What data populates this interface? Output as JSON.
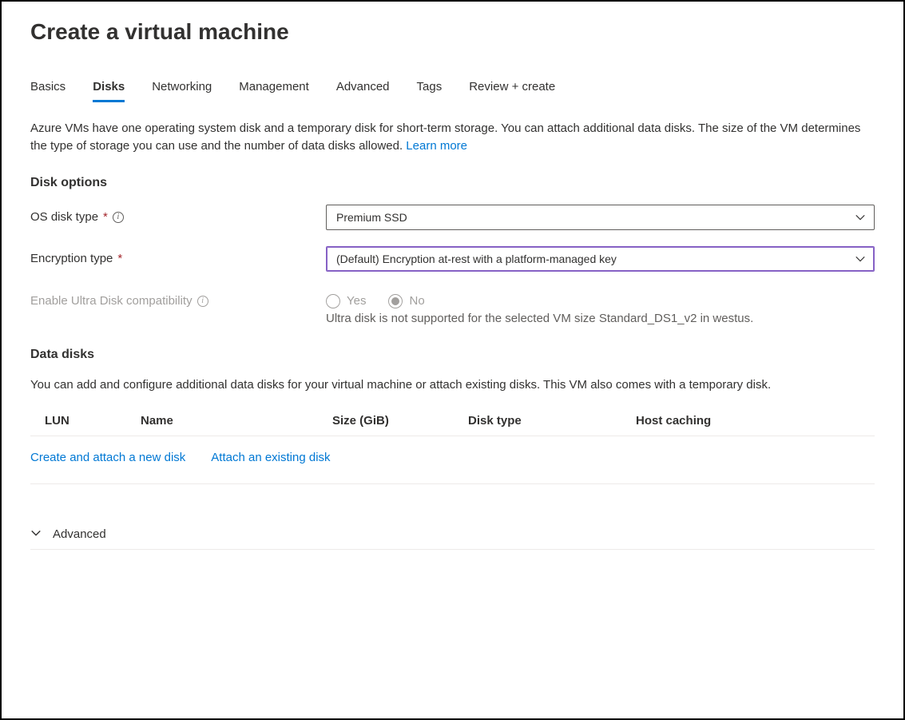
{
  "title": "Create a virtual machine",
  "tabs": [
    {
      "label": "Basics",
      "active": false
    },
    {
      "label": "Disks",
      "active": true
    },
    {
      "label": "Networking",
      "active": false
    },
    {
      "label": "Management",
      "active": false
    },
    {
      "label": "Advanced",
      "active": false
    },
    {
      "label": "Tags",
      "active": false
    },
    {
      "label": "Review + create",
      "active": false
    }
  ],
  "intro": {
    "text": "Azure VMs have one operating system disk and a temporary disk for short-term storage. You can attach additional data disks. The size of the VM determines the type of storage you can use and the number of data disks allowed.  ",
    "learn_more": "Learn more"
  },
  "disk_options": {
    "heading": "Disk options",
    "os_disk_type": {
      "label": "OS disk type",
      "required": true,
      "value": "Premium SSD"
    },
    "encryption_type": {
      "label": "Encryption type",
      "required": true,
      "value": "(Default) Encryption at-rest with a platform-managed key"
    },
    "ultra_disk": {
      "label": "Enable Ultra Disk compatibility",
      "yes": "Yes",
      "no": "No",
      "selected": "No",
      "helper": "Ultra disk is not supported for the selected VM size Standard_DS1_v2 in westus."
    }
  },
  "data_disks": {
    "heading": "Data disks",
    "description": "You can add and configure additional data disks for your virtual machine or attach existing disks. This VM also comes with a temporary disk.",
    "columns": {
      "lun": "LUN",
      "name": "Name",
      "size": "Size (GiB)",
      "type": "Disk type",
      "cache": "Host caching"
    },
    "create_link": "Create and attach a new disk",
    "attach_link": "Attach an existing disk"
  },
  "advanced": {
    "label": "Advanced"
  }
}
